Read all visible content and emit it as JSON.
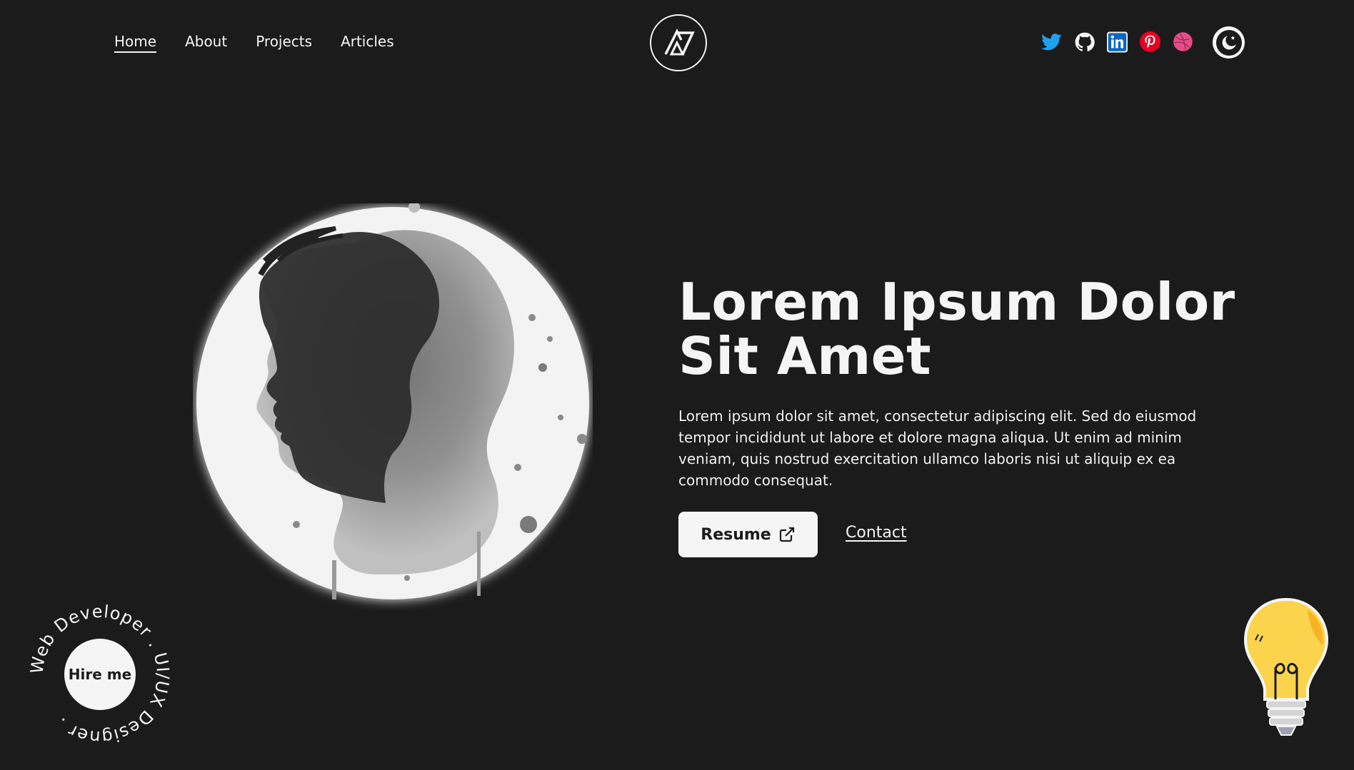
{
  "nav": {
    "items": [
      {
        "label": "Home",
        "active": true
      },
      {
        "label": "About"
      },
      {
        "label": "Projects"
      },
      {
        "label": "Articles"
      }
    ]
  },
  "socials": [
    "twitter-icon",
    "github-icon",
    "linkedin-icon",
    "pinterest-icon",
    "dribbble-icon"
  ],
  "colors": {
    "background": "#1b1b1b",
    "text": "#f5f5f5",
    "twitter": "#1da1f2",
    "linkedin": "#0a66c2",
    "pinterest": "#e60023",
    "dribbble": "#ea4c89",
    "bulb": "#fcd34d"
  },
  "hero": {
    "title_line1": "Lorem Ipsum Dolor",
    "title_line2": "Sit Amet",
    "description": "Lorem ipsum dolor sit amet, consectetur adipiscing elit. Sed do eiusmod tempor incididunt ut labore et dolore magna aliqua. Ut enim ad minim veniam, quis nostrud exercitation ullamco laboris nisi ut aliquip ex ea commodo consequat.",
    "resume_label": "Resume",
    "contact_label": "Contact"
  },
  "hire": {
    "button_label": "Hire me",
    "ring_text": "Web Developer . UI/UX Designer . "
  }
}
